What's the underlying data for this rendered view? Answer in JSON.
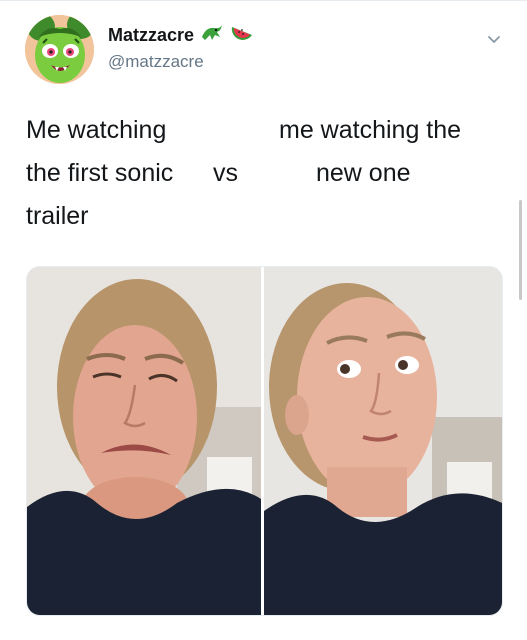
{
  "tweet": {
    "display_name": "Matzzacre",
    "handle": "@matzzacre",
    "name_emojis": [
      "crocodile-emoji",
      "watermelon-emoji"
    ],
    "text_left_line1": "Me watching",
    "text_left_line2": "the first sonic",
    "text_left_line3": "trailer",
    "text_vs": "vs",
    "text_right_line1": "me watching the",
    "text_right_line2": "new one"
  },
  "colors": {
    "text": "#14171a",
    "secondary_text": "#657786",
    "avatar_green": "#6fbf3b",
    "shirt": "#1b2233"
  },
  "icons": [
    "chevron-down-icon"
  ]
}
